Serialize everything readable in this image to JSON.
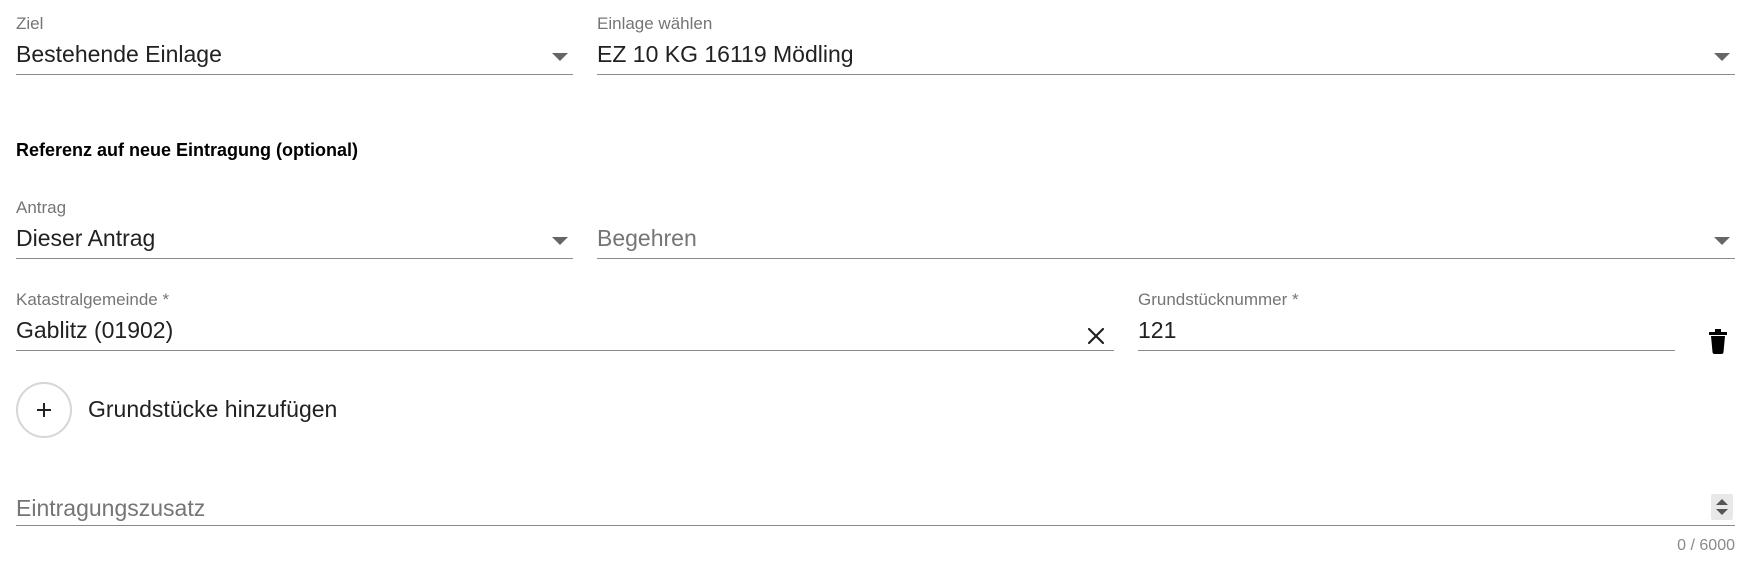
{
  "ziel": {
    "label": "Ziel",
    "value": "Bestehende Einlage",
    "icon": "dropdown-arrow-icon"
  },
  "einlage": {
    "label": "Einlage wählen",
    "value": "EZ 10 KG 16119 Mödling",
    "icon": "dropdown-arrow-icon"
  },
  "section": {
    "title": "Referenz auf neue Eintragung (optional)"
  },
  "antrag": {
    "label": "Antrag",
    "value": "Dieser Antrag",
    "icon": "dropdown-arrow-icon"
  },
  "begehren": {
    "placeholder": "Begehren",
    "icon": "dropdown-arrow-icon"
  },
  "katastralgemeinde": {
    "label": "Katastralgemeinde *",
    "value": "Gablitz (01902)",
    "clear_icon": "close-icon"
  },
  "grundstuecknummer": {
    "label": "Grundstücknummer *",
    "value": "121",
    "delete_icon": "trash-icon"
  },
  "add_grundstuecke": {
    "label": "Grundstücke hinzufügen",
    "icon": "plus-icon"
  },
  "eintragungszusatz": {
    "placeholder": "Eintragungszusatz",
    "counter": "0 / 6000"
  },
  "colors": {
    "text": "#212121",
    "label": "#757575",
    "underline": "#8a8a8a",
    "icon": "#000000"
  }
}
